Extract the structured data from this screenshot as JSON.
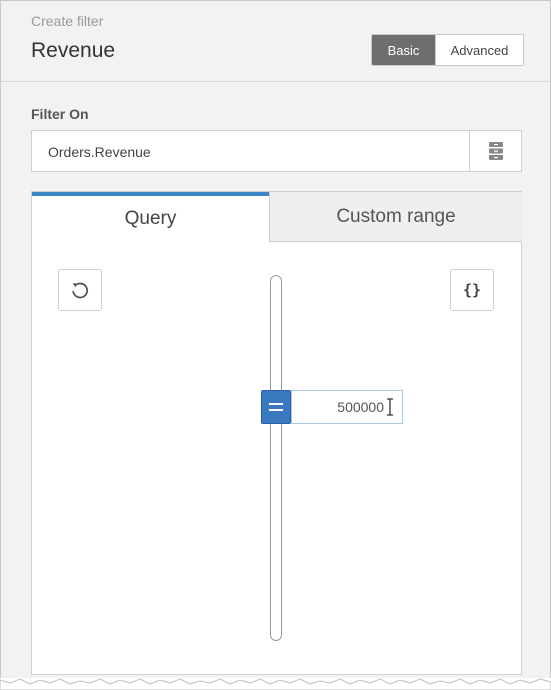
{
  "header": {
    "subtitle": "Create filter",
    "title": "Revenue",
    "mode_toggle": {
      "basic_label": "Basic",
      "advanced_label": "Advanced",
      "selected": "Basic"
    }
  },
  "filter_on": {
    "label": "Filter On",
    "value": "Orders.Revenue",
    "side_icon": "database-icon"
  },
  "tabs": [
    {
      "label": "Query",
      "active": true
    },
    {
      "label": "Custom range",
      "active": false
    }
  ],
  "query": {
    "reset_icon": "reset-icon",
    "json_label": "{}",
    "slider_value": "500000"
  },
  "colors": {
    "accent": "#3d87c9",
    "handle": "#3a78c0",
    "toggle_active": "#6e6e6e"
  }
}
